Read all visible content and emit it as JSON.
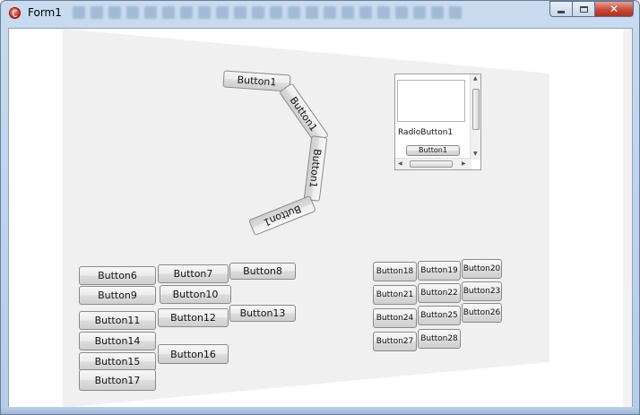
{
  "window": {
    "title": "Form1",
    "close_glyph": "✕"
  },
  "listbox": {
    "radio_label": "RadioButton1",
    "button_label": "Button1",
    "arrow_up": "▲",
    "arrow_down": "▼",
    "arrow_left": "◀",
    "arrow_right": "▶"
  },
  "chain_buttons": [
    {
      "label": "Button1"
    },
    {
      "label": "Button1"
    },
    {
      "label": "Button1"
    },
    {
      "label": "Button1"
    }
  ],
  "grid_left": [
    {
      "label": "Button6"
    },
    {
      "label": "Button7"
    },
    {
      "label": "Button8"
    },
    {
      "label": "Button9"
    },
    {
      "label": "Button10"
    },
    {
      "label": "Button11"
    },
    {
      "label": "Button12"
    },
    {
      "label": "Button13"
    },
    {
      "label": "Button14"
    },
    {
      "label": "Button15"
    },
    {
      "label": "Button16"
    },
    {
      "label": "Button17"
    }
  ],
  "grid_right": [
    {
      "label": "Button18"
    },
    {
      "label": "Button19"
    },
    {
      "label": "Button20"
    },
    {
      "label": "Button21"
    },
    {
      "label": "Button22"
    },
    {
      "label": "Button23"
    },
    {
      "label": "Button24"
    },
    {
      "label": "Button25"
    },
    {
      "label": "Button26"
    },
    {
      "label": "Button27"
    },
    {
      "label": "Button28"
    }
  ]
}
